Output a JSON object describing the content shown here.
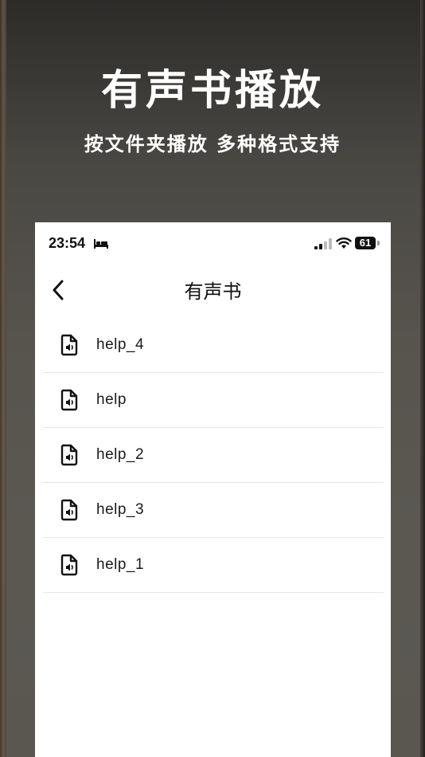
{
  "promo": {
    "title": "有声书播放",
    "subtitle": "按文件夹播放 多种格式支持"
  },
  "status_bar": {
    "time": "23:54",
    "battery": "61",
    "icons": [
      "bed-icon",
      "signal-icon",
      "wifi-icon",
      "battery-icon"
    ]
  },
  "nav": {
    "title": "有声书",
    "back_icon": "chevron-left-icon"
  },
  "files": [
    {
      "name": "help_4",
      "icon": "audio-file-icon"
    },
    {
      "name": "help",
      "icon": "audio-file-icon"
    },
    {
      "name": "help_2",
      "icon": "audio-file-icon"
    },
    {
      "name": "help_3",
      "icon": "audio-file-icon"
    },
    {
      "name": "help_1",
      "icon": "audio-file-icon"
    }
  ],
  "colors": {
    "background": "#55524c",
    "phone_background": "#ffffff",
    "divider": "#e8e8e8",
    "text": "#111111"
  }
}
